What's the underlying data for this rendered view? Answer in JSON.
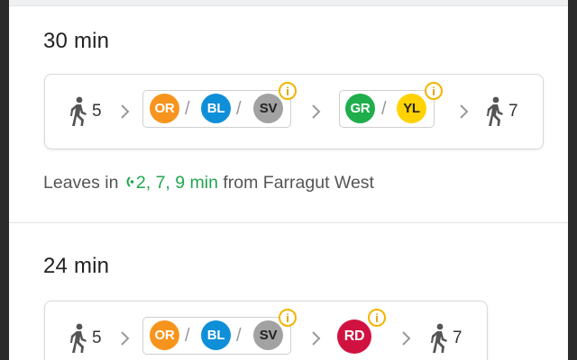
{
  "routes": [
    {
      "duration": "30 min",
      "walk_start": "5",
      "walk_end": "7",
      "legs": [
        {
          "lines": [
            {
              "code": "OR",
              "color": "#f7941d",
              "text_color": "#ffffff"
            },
            {
              "code": "BL",
              "color": "#0f8fd8",
              "text_color": "#ffffff"
            },
            {
              "code": "SV",
              "color": "#a1a2a1",
              "text_color": "#222222"
            }
          ],
          "info": "i"
        },
        {
          "lines": [
            {
              "code": "GR",
              "color": "#1fae4b",
              "text_color": "#ffffff"
            },
            {
              "code": "YL",
              "color": "#ffd200",
              "text_color": "#222222"
            }
          ],
          "info": "i"
        }
      ],
      "leaves_prefix": "Leaves in",
      "leaves_times": "2, 7, 9 min",
      "leaves_suffix": "from Farragut West"
    },
    {
      "duration": "24 min",
      "walk_start": "5",
      "walk_end": "7",
      "legs": [
        {
          "lines": [
            {
              "code": "OR",
              "color": "#f7941d",
              "text_color": "#ffffff"
            },
            {
              "code": "BL",
              "color": "#0f8fd8",
              "text_color": "#ffffff"
            },
            {
              "code": "SV",
              "color": "#a1a2a1",
              "text_color": "#222222"
            }
          ],
          "info": "i"
        },
        {
          "lines": [
            {
              "code": "RD",
              "color": "#d11241",
              "text_color": "#ffffff"
            }
          ],
          "info": "i"
        }
      ]
    }
  ],
  "separator": "/",
  "icons": {
    "walk": "walking-person-icon",
    "chevron": "chevron-right-icon",
    "info": "info-icon",
    "realtime": "realtime-signal-icon"
  },
  "colors": {
    "realtime_green": "#21a651",
    "info_yellow": "#f2b400"
  }
}
